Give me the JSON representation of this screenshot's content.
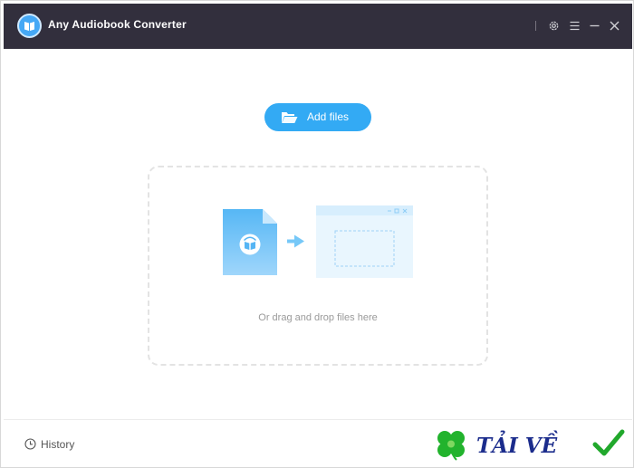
{
  "window": {
    "title": "Any Audiobook Converter",
    "controls": {
      "settings_icon": "gear-icon",
      "menu_icon": "hamburger-menu-icon",
      "minimize_icon": "minimize-icon",
      "close_icon": "close-icon"
    }
  },
  "main": {
    "add_files_label": "Add files",
    "add_files_icon": "folder-open-icon",
    "drop_hint": "Or drag and drop files here"
  },
  "footer": {
    "history_label": "History",
    "history_icon": "clock-icon"
  },
  "watermark": {
    "text": "TẢI VỀ"
  },
  "colors": {
    "titlebar": "#322f3d",
    "accent": "#33aaf4",
    "drop_border": "#e3e3e3",
    "hint_text": "#9a9a9a",
    "watermark_text": "#1b2c8c",
    "watermark_check": "#21a82c",
    "watermark_clover": "#22b32d"
  }
}
